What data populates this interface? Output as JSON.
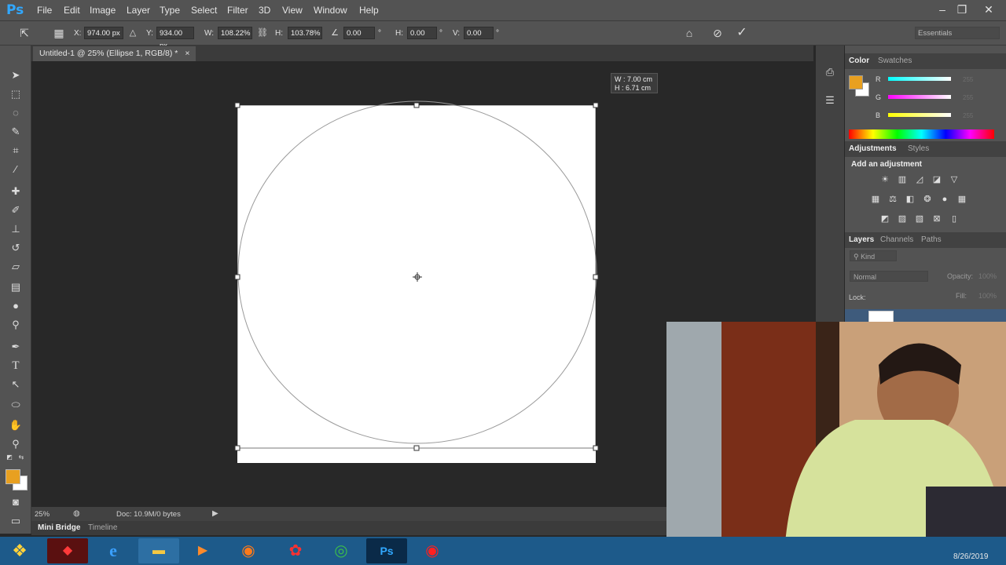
{
  "app": {
    "logo": "Ps"
  },
  "menu": [
    "File",
    "Edit",
    "Image",
    "Layer",
    "Type",
    "Select",
    "Filter",
    "3D",
    "View",
    "Window",
    "Help"
  ],
  "window_controls": {
    "minimize_icon": "minimize-icon",
    "restore_icon": "restore-icon",
    "close_icon": "close-icon"
  },
  "options": {
    "x_label": "X:",
    "x_value": "974.00 px",
    "y_label": "Y:",
    "y_value": "934.00 px",
    "w_label": "W:",
    "w_value": "108.22%",
    "h_label": "H:",
    "h_value": "103.78%",
    "angle_value": "0.00",
    "hskew_label": "H:",
    "hskew_value": "0.00",
    "vskew_label": "V:",
    "vskew_value": "0.00",
    "degree": "°",
    "workspace": "Essentials"
  },
  "document": {
    "tab_title": "Untitled-1 @ 25% (Ellipse 1, RGB/8) *",
    "close": "×"
  },
  "size_tooltip": {
    "w": "W : 7.00 cm",
    "h": "H : 6.71 cm"
  },
  "status": {
    "zoom": "25%",
    "doc": "Doc: 10.9M/0 bytes"
  },
  "bottom_tabs": [
    "Mini Bridge",
    "Timeline"
  ],
  "color_panel": {
    "tabs": [
      "Color",
      "Swatches"
    ],
    "channels": [
      {
        "label": "R",
        "value": "255"
      },
      {
        "label": "G",
        "value": "255"
      },
      {
        "label": "B",
        "value": "255"
      }
    ],
    "foreground": "#e8a020",
    "background": "#ffffff"
  },
  "adjustments_panel": {
    "tabs": [
      "Adjustments",
      "Styles"
    ],
    "heading": "Add an adjustment"
  },
  "layers_panel": {
    "tabs": [
      "Layers",
      "Channels",
      "Paths"
    ],
    "kind": "Kind",
    "blend_mode": "Normal",
    "opacity_label": "Opacity:",
    "opacity_value": "100%",
    "lock_label": "Lock:",
    "fill_label": "Fill:",
    "fill_value": "100%"
  },
  "taskbar": {
    "date": "8/26/2019"
  }
}
